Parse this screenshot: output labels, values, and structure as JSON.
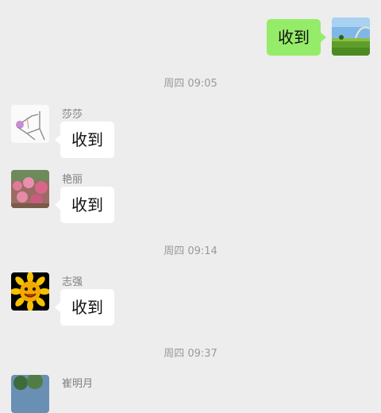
{
  "messages": {
    "self_1": {
      "text": "收到",
      "avatar": "landscape-photo-avatar"
    },
    "time_1": "周四 09:05",
    "shasha": {
      "sender": "莎莎",
      "text": "收到",
      "avatar": "sketch-figure-avatar"
    },
    "yanli": {
      "sender": "艳丽",
      "text": "收到",
      "avatar": "pink-flowers-avatar"
    },
    "time_2": "周四 09:14",
    "zhiqiang": {
      "sender": "志强",
      "text": "收到",
      "avatar": "sunflower-smiley-avatar"
    },
    "time_3": "周四 09:37",
    "partial_sender": {
      "sender": "崔明月",
      "avatar": "tree-photo-avatar"
    }
  },
  "colors": {
    "background": "#ededed",
    "incoming_bubble": "#ffffff",
    "outgoing_bubble": "#95ec69",
    "timestamp_text": "#9a9a9a",
    "sender_text": "#7d7d7d"
  }
}
